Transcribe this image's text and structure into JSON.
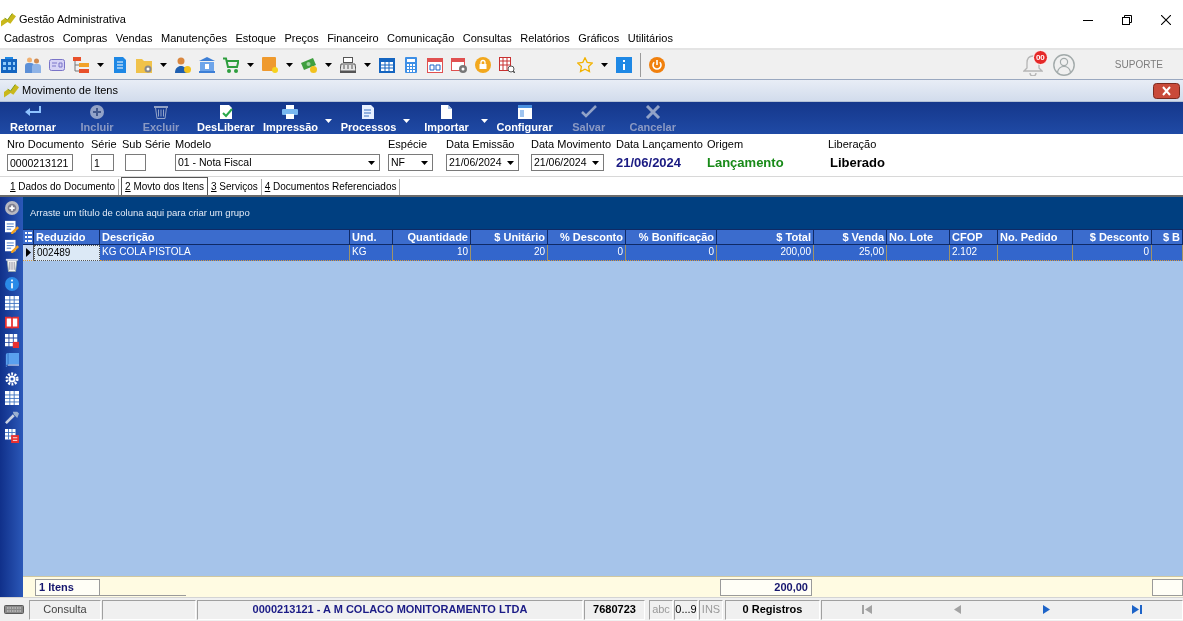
{
  "window": {
    "title": "Gestão Administrativa"
  },
  "menu": [
    "Cadastros",
    "Compras",
    "Vendas",
    "Manutenções",
    "Estoque",
    "Preços",
    "Financeiro",
    "Comunicação",
    "Consultas",
    "Relatórios",
    "Gráficos",
    "Utilitários"
  ],
  "header": {
    "notifications": "00",
    "user": "SUPORTE"
  },
  "document_window": {
    "title": "Movimento de Itens",
    "actions": [
      {
        "label": "Retornar",
        "disabled": false,
        "dropdown": false
      },
      {
        "label": "Incluir",
        "disabled": true,
        "dropdown": false
      },
      {
        "label": "Excluir",
        "disabled": true,
        "dropdown": false
      },
      {
        "label": "DesLiberar",
        "disabled": false,
        "dropdown": false
      },
      {
        "label": "Impressão",
        "disabled": false,
        "dropdown": true
      },
      {
        "label": "Processos",
        "disabled": false,
        "dropdown": true
      },
      {
        "label": "Importar",
        "disabled": false,
        "dropdown": true
      },
      {
        "label": "Configurar",
        "disabled": false,
        "dropdown": false
      },
      {
        "label": "Salvar",
        "disabled": true,
        "dropdown": false
      },
      {
        "label": "Cancelar",
        "disabled": true,
        "dropdown": false
      }
    ],
    "fields": [
      {
        "kind": "input",
        "label": "Nro Documento",
        "value": "0000213121"
      },
      {
        "kind": "input",
        "label": "Série",
        "value": "1"
      },
      {
        "kind": "input",
        "label": "Sub Série"
      },
      {
        "kind": "select",
        "label": "Modelo",
        "value": "01 - Nota Fiscal"
      },
      {
        "kind": "select",
        "label": "Espécie",
        "value": "NF"
      },
      {
        "kind": "select",
        "label": "Data Emissão",
        "value": "21/06/2024"
      },
      {
        "kind": "select",
        "label": "Data Movimento",
        "value": "21/06/2024"
      },
      {
        "kind": "display",
        "label": "Data Lançamento",
        "value": "21/06/2024",
        "color": "#1a1a82"
      },
      {
        "kind": "display",
        "label": "Origem",
        "value": "Lançamento",
        "color": "#178a17"
      },
      {
        "kind": "display",
        "label": "Liberação",
        "value": "Liberado",
        "color": "#000000"
      }
    ],
    "tabs": [
      {
        "number": "1",
        "label": "Dados do Documento",
        "selected": false
      },
      {
        "number": "2",
        "label": "Movto dos Itens",
        "selected": true
      },
      {
        "number": "3",
        "label": "Serviços",
        "selected": false
      },
      {
        "number": "4",
        "label": "Documentos Referenciados",
        "selected": false
      }
    ],
    "grid": {
      "group_hint": "Arraste um título de coluna aqui para criar um grupo",
      "columns": [
        {
          "label": "Reduzido",
          "kind": "text"
        },
        {
          "label": "Descrição",
          "kind": "text"
        },
        {
          "label": "Und.",
          "kind": "text"
        },
        {
          "label": "Quantidade",
          "kind": "number"
        },
        {
          "label": "$ Unitário",
          "kind": "number"
        },
        {
          "label": "% Desconto",
          "kind": "number"
        },
        {
          "label": "% Bonificação",
          "kind": "number"
        },
        {
          "label": "$ Total",
          "kind": "number"
        },
        {
          "label": "$ Venda",
          "kind": "number"
        },
        {
          "label": "No. Lote",
          "kind": "text"
        },
        {
          "label": "CFOP",
          "kind": "text"
        },
        {
          "label": "No. Pedido",
          "kind": "text"
        },
        {
          "label": "$ Desconto",
          "kind": "number"
        },
        {
          "label": "$ B",
          "kind": "number"
        }
      ],
      "rows": [
        {
          "selected": true,
          "cells": [
            "002489",
            "KG COLA PISTOLA",
            "KG",
            "10",
            "20",
            "0",
            "0",
            "200,00",
            "25,00",
            null,
            "2.102",
            null,
            "0",
            null
          ]
        }
      ],
      "footer": {
        "count": "1 Itens",
        "total": "200,00"
      }
    }
  },
  "status_bar": {
    "mode": "Consulta",
    "document": "0000213121 - A M COLACO MONITORAMENTO LTDA",
    "code": "7680723",
    "indicators": [
      {
        "label": "abc",
        "on": false
      },
      {
        "label": "0...9",
        "on": true
      },
      {
        "label": "INS",
        "on": false
      }
    ],
    "records": "0 Registros",
    "navigation": [
      {
        "kind": "first",
        "disabled": true
      },
      {
        "kind": "previous",
        "disabled": true
      },
      {
        "kind": "next",
        "disabled": false
      },
      {
        "kind": "last",
        "disabled": false
      }
    ]
  }
}
